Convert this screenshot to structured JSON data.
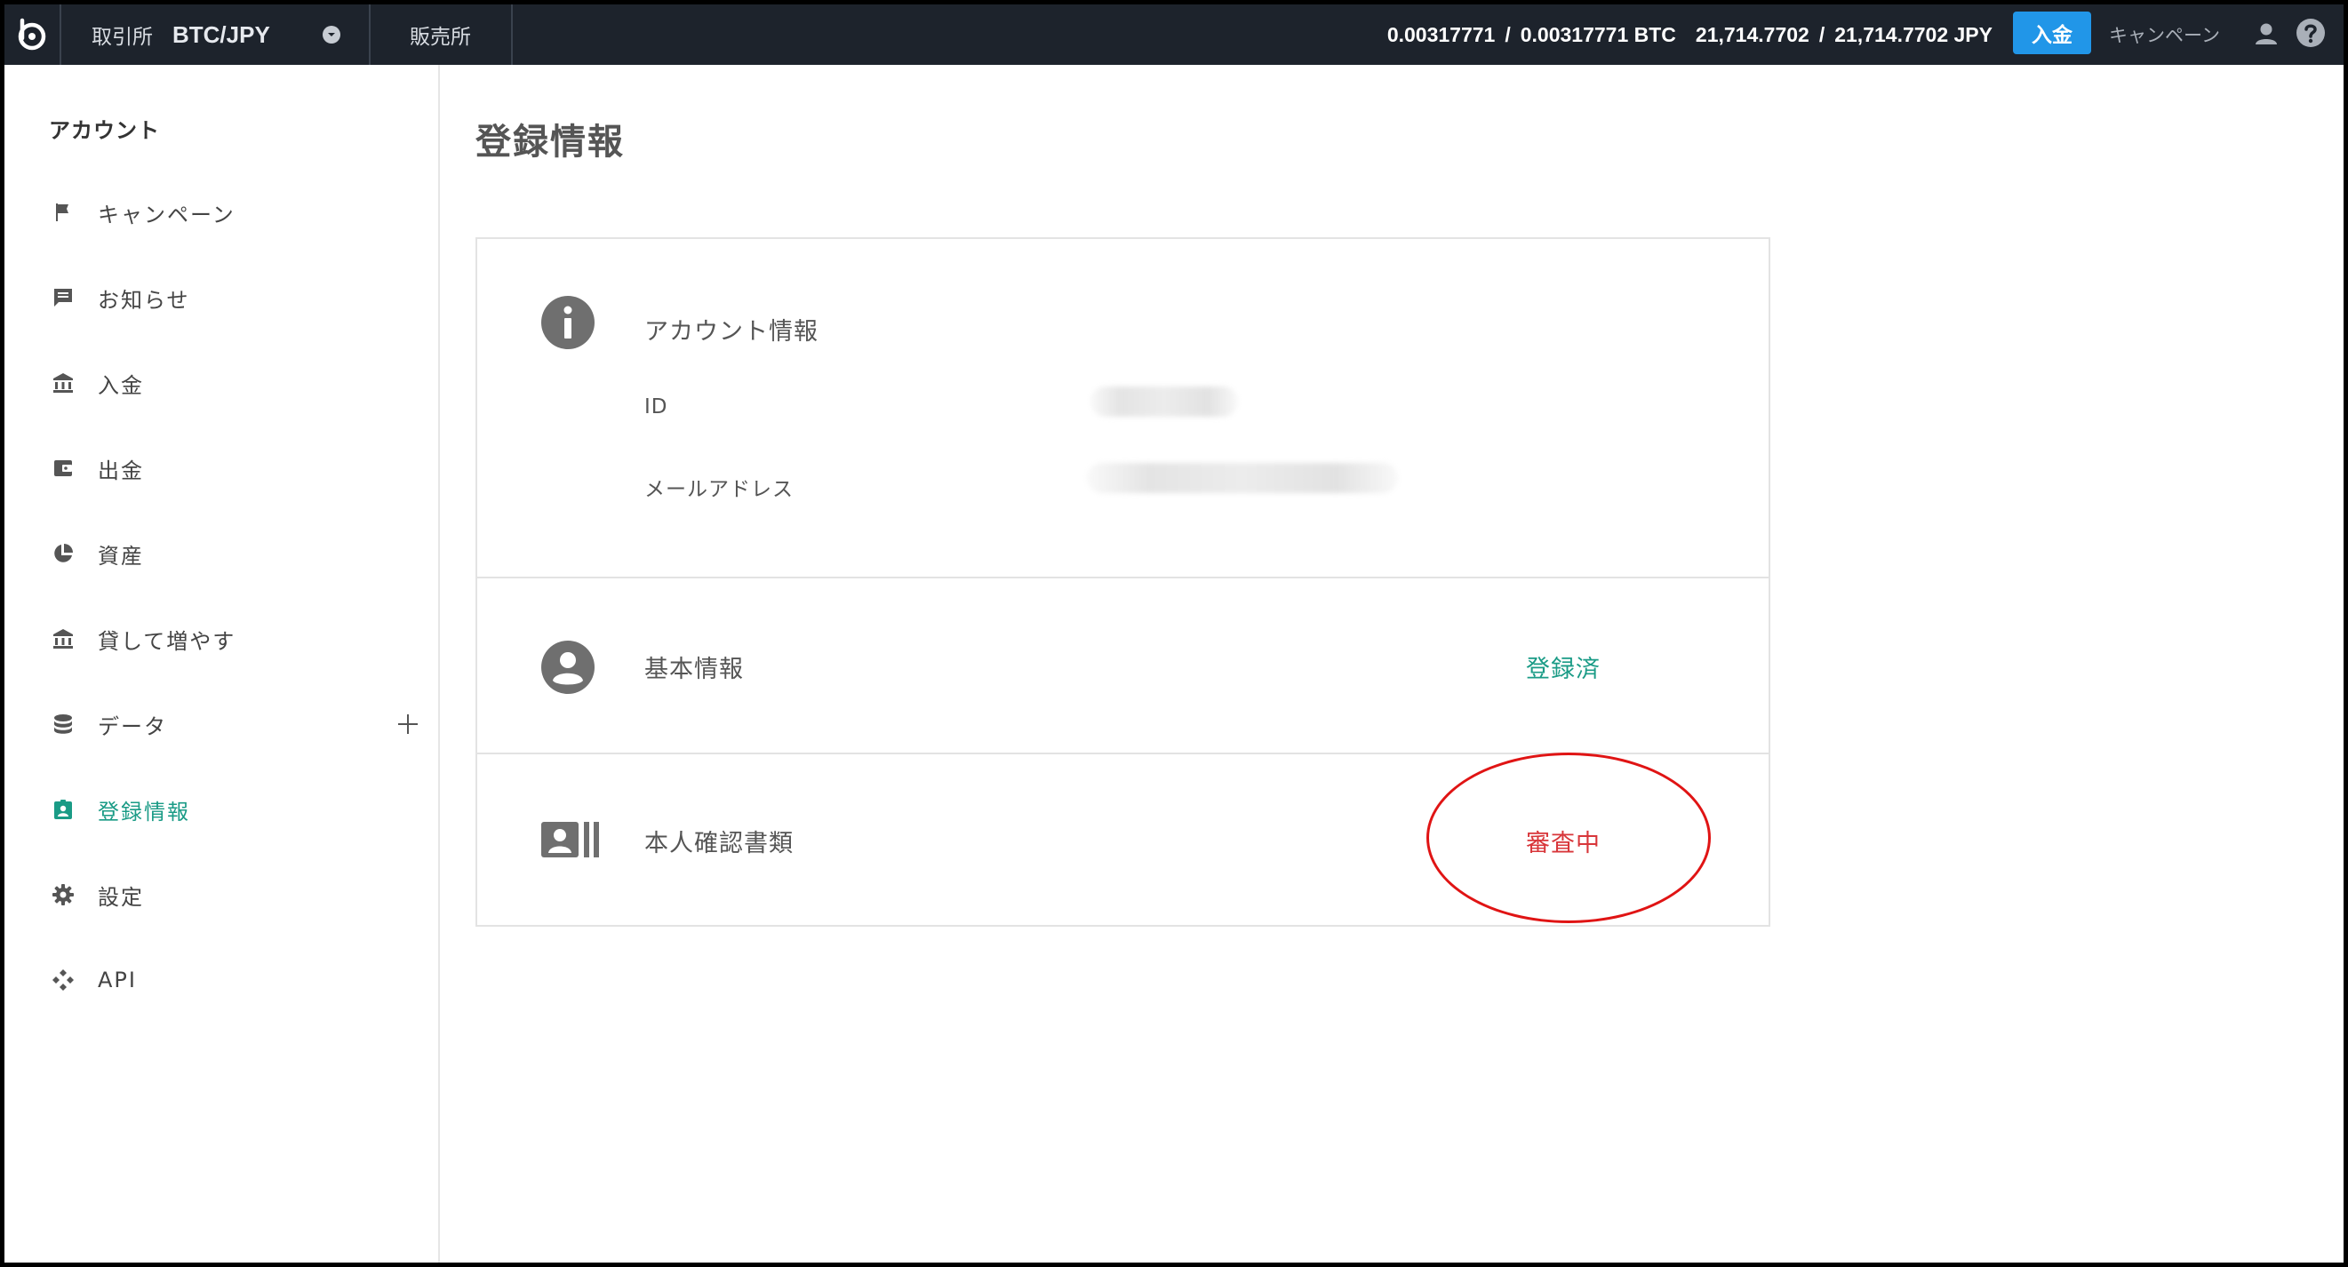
{
  "topbar": {
    "exchange_label": "取引所",
    "pair": "BTC/JPY",
    "hanbaisho_label": "販売所",
    "btc_available": "0.00317771",
    "btc_total": "0.00317771 BTC",
    "jpy_available": "21,714.7702",
    "jpy_total": "21,714.7702 JPY",
    "separator": "/",
    "deposit_label": "入金",
    "campaign_label": "キャンペーン"
  },
  "sidebar": {
    "title": "アカウント",
    "items": [
      {
        "label": "キャンペーン",
        "icon": "flag-icon"
      },
      {
        "label": "お知らせ",
        "icon": "message-icon"
      },
      {
        "label": "入金",
        "icon": "bank-icon"
      },
      {
        "label": "出金",
        "icon": "wallet-icon"
      },
      {
        "label": "資産",
        "icon": "pie-chart-icon"
      },
      {
        "label": "貸して増やす",
        "icon": "bank-icon"
      },
      {
        "label": "データ",
        "icon": "database-icon"
      },
      {
        "label": "登録情報",
        "icon": "id-badge-icon"
      },
      {
        "label": "設定",
        "icon": "gear-icon"
      },
      {
        "label": "API",
        "icon": "api-icon"
      }
    ],
    "active_item": "登録情報"
  },
  "main": {
    "page_title": "登録情報",
    "account_section": {
      "title": "アカウント情報",
      "id_label": "ID",
      "email_label": "メールアドレス"
    },
    "basic_section": {
      "title": "基本情報",
      "status": "登録済"
    },
    "identity_section": {
      "title": "本人確認書類",
      "status": "審査中"
    }
  },
  "colors": {
    "topbar_bg": "#1d232c",
    "accent_teal": "#1a9b86",
    "deposit_blue": "#2196e8",
    "status_red": "#d8363a",
    "annotation_red": "#e01414"
  }
}
